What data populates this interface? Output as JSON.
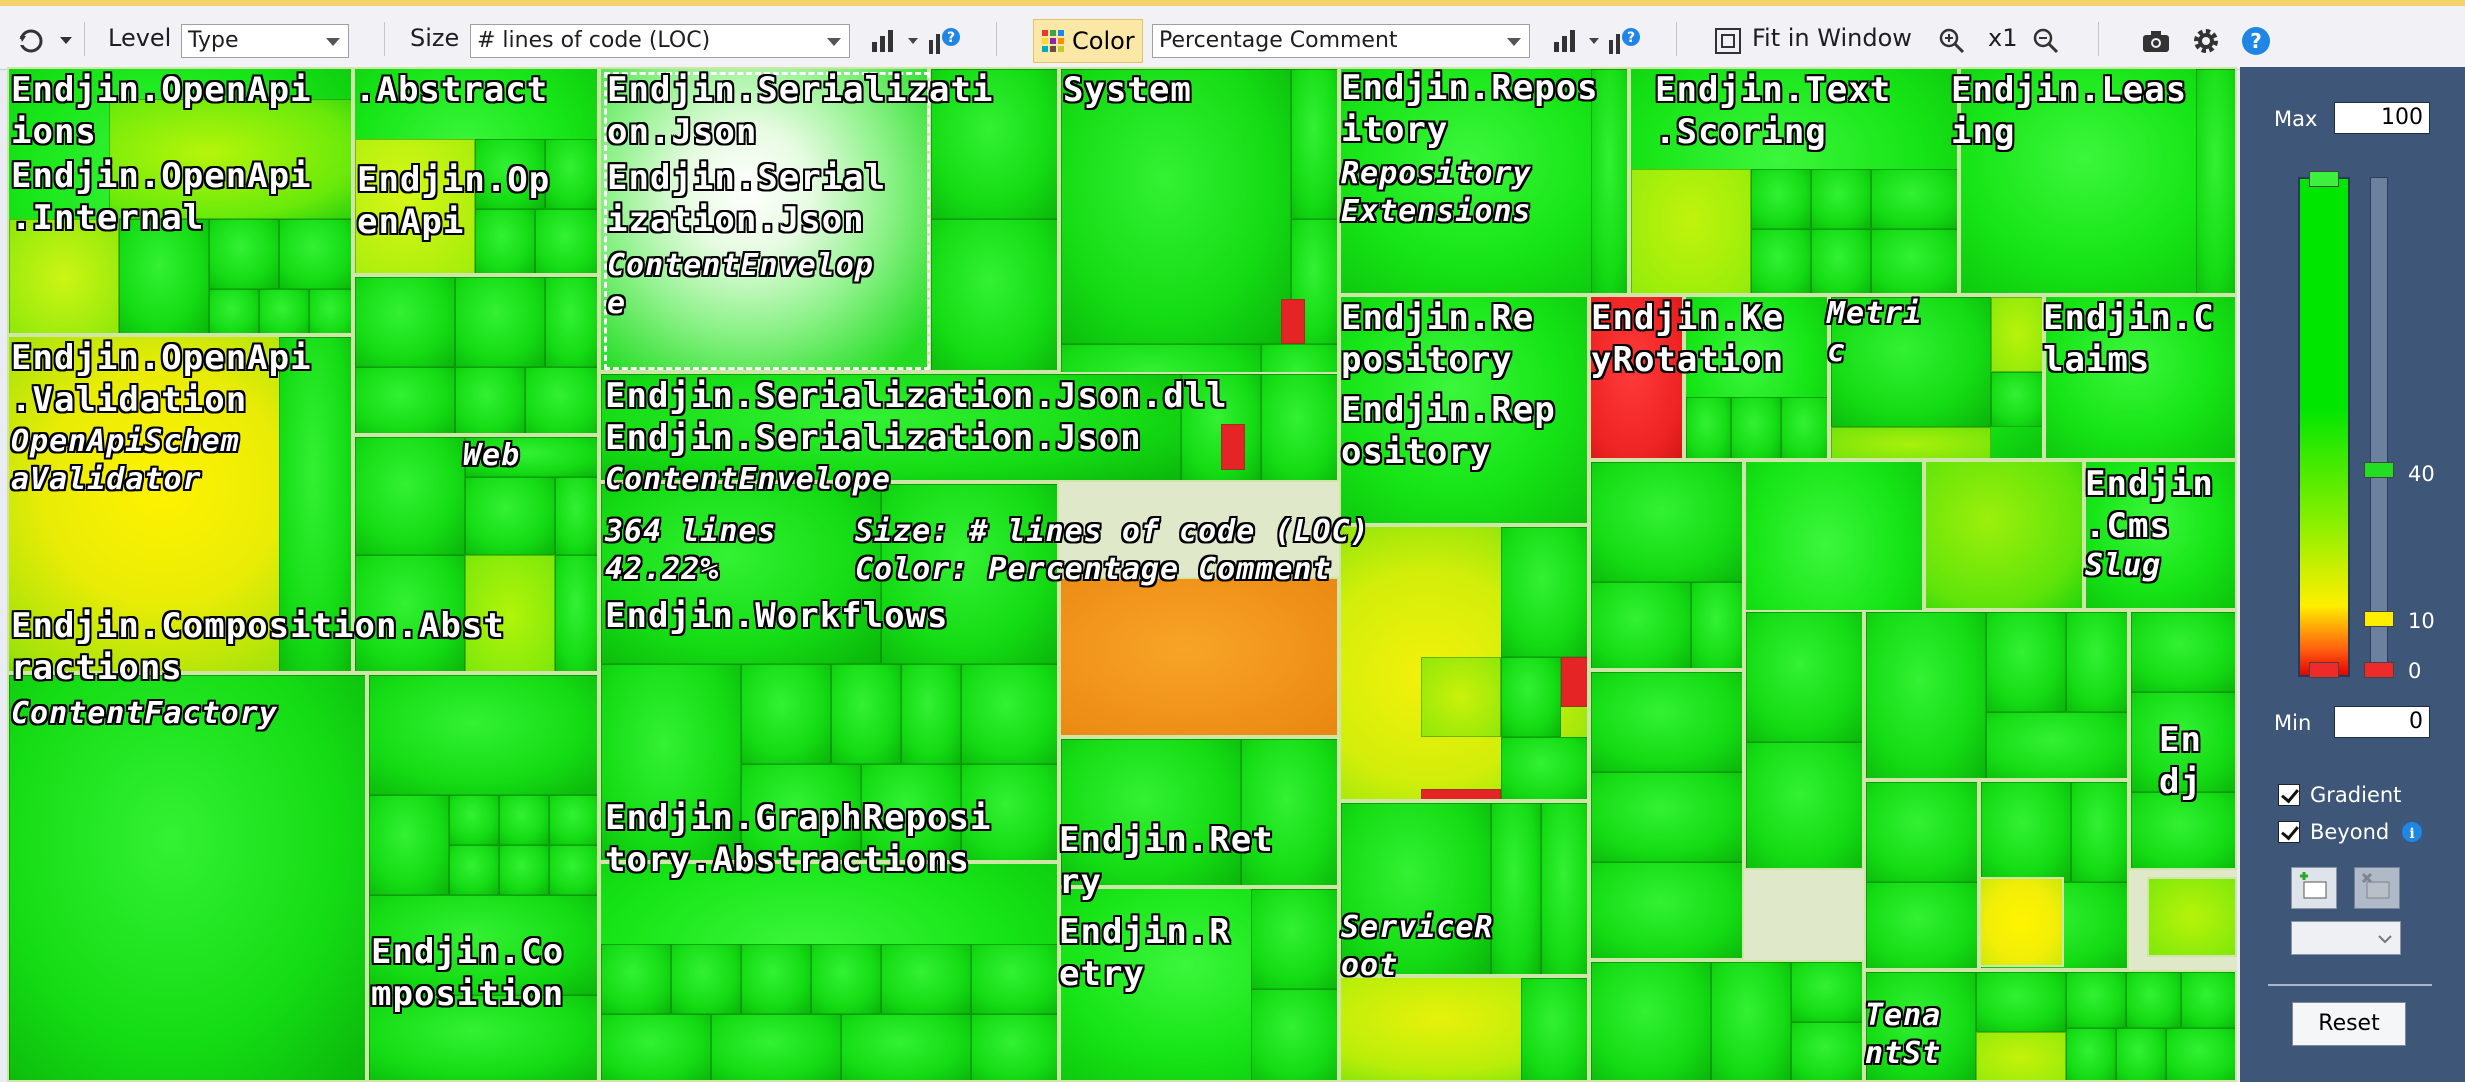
{
  "toolbar": {
    "level_label": "Level",
    "level_value": "Type",
    "size_label": "Size",
    "size_value": "# lines of code (LOC)",
    "color_label": "Color",
    "color_value": "Percentage Comment",
    "fit_label": "Fit in Window",
    "zoom_value": "x1"
  },
  "treemap": {
    "labels": {
      "openapi_ns": "Endjin.OpenApi\nions",
      "openapi_abstract": ".Abstract",
      "openapi_internal": "Endjin.OpenApi\n.Internal",
      "openapi_small": "Endjin.Op\nenApi",
      "openapi_validation": "Endjin.OpenApi\n.Validation",
      "openapi_validator": "OpenApiSchem\naValidator",
      "web": "Web",
      "serialization_ns": "Endjin.Serializati\non.Json",
      "serialization_asm": "Endjin.Serial\nization.Json",
      "content_envelope_a": "ContentEnvelop\ne",
      "system": "System",
      "repository_ext_ns": "Endjin.Repos\nitory",
      "repository_ext_type": "Repository\nExtensions",
      "text_scoring": "Endjin.Text\n.Scoring",
      "leasing": "Endjin.Leas\ning",
      "serialization_dll": "Endjin.Serialization.Json.dll",
      "serialization_ns2": "Endjin.Serialization.Json",
      "content_envelope_b": "ContentEnvelope",
      "tooltip_lines": "364 lines",
      "tooltip_size": "Size: # lines of code (LOC)",
      "tooltip_pct": "42.22%",
      "tooltip_color": "Color: Percentage Comment",
      "repository_ns": "Endjin.Re\npository",
      "repository_asm": "Endjin.Rep\nository",
      "key_rotation": "Endjin.Ke\nyRotation",
      "metric": "Metri\nc",
      "claims": "Endjin.C\nlaims",
      "cms": "Endjin\n.Cms",
      "slug": "Slug",
      "composition_abs": "Endjin.Composition.Abst\nractions",
      "content_factory": "ContentFactory",
      "workflows": "Endjin.Workflows",
      "composition": "Endjin.Co\nmposition",
      "graph_repo": "Endjin.GraphReposi\ntory.Abstractions",
      "retry_ns": "Endjin.Ret\nry",
      "retry_asm": "Endjin.R\netry",
      "service_root": "ServiceR\noot",
      "tenant": "Tena\nntSt",
      "endj": "En\ndj"
    }
  },
  "panel": {
    "max_label": "Max",
    "max_value": "100",
    "min_label": "Min",
    "min_value": "0",
    "tick_40": "40",
    "tick_10": "10",
    "tick_0": "0",
    "gradient_label": "Gradient",
    "beyond_label": "Beyond",
    "reset_label": "Reset"
  },
  "colors": {
    "green": "#16e516",
    "yellow": "#ffee00",
    "orange": "#f39a1d",
    "red": "#ee2222",
    "panel_bg": "#3e5677"
  }
}
